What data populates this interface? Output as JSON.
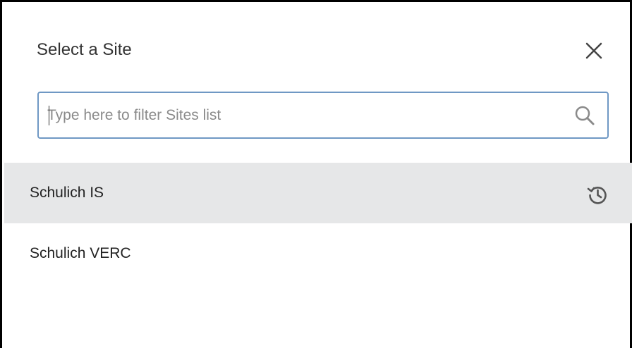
{
  "dialog": {
    "title": "Select a Site",
    "close_icon": "close-icon"
  },
  "search": {
    "value": "",
    "placeholder": "Type here to filter Sites list",
    "icon": "search-icon"
  },
  "sites": [
    {
      "label": "Schulich IS",
      "selected": true,
      "icon": "history-icon"
    },
    {
      "label": "Schulich VERC",
      "selected": false
    }
  ],
  "colors": {
    "input_border": "#6f98c4",
    "selected_row_bg": "#e6e7e8",
    "frame_border": "#000000"
  }
}
